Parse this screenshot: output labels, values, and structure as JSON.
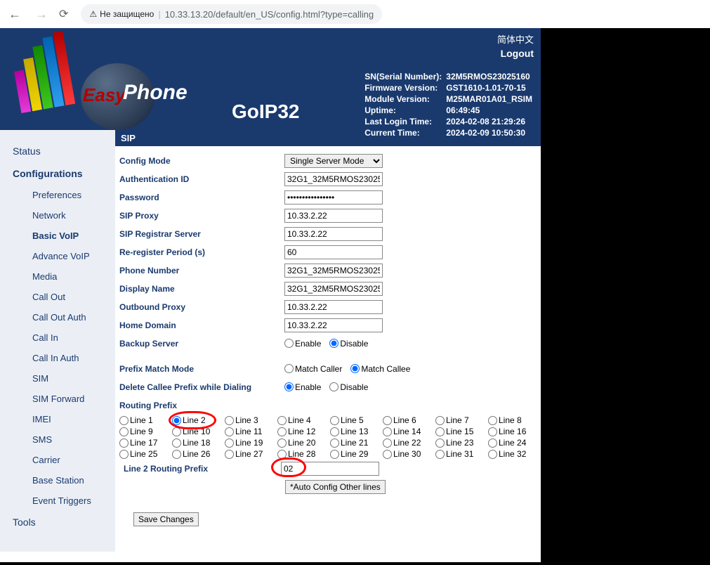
{
  "browser": {
    "secure_label": "Не защищено",
    "url": "10.33.13.20/default/en_US/config.html?type=calling"
  },
  "header": {
    "product": "GoIP32",
    "lang_link": "简体中文",
    "logout": "Logout",
    "info": {
      "sn_label": "SN(Serial Number):",
      "sn": "32M5RMOS23025160",
      "fw_label": "Firmware Version:",
      "fw": "GST1610-1.01-70-15",
      "mod_label": "Module Version:",
      "mod": "M25MAR01A01_RSIM",
      "uptime_label": "Uptime:",
      "uptime": "06:49:45",
      "last_label": "Last Login Time:",
      "last": "2024-02-08 21:29:26",
      "cur_label": "Current Time:",
      "cur": "2024-02-09 10:50:30"
    }
  },
  "sidebar": {
    "status": "Status",
    "config": "Configurations",
    "items": [
      "Preferences",
      "Network",
      "Basic VoIP",
      "Advance VoIP",
      "Media",
      "Call Out",
      "Call Out Auth",
      "Call In",
      "Call In Auth",
      "SIM",
      "SIM Forward",
      "IMEI",
      "SMS",
      "Carrier",
      "Base Station",
      "Event Triggers"
    ],
    "tools": "Tools"
  },
  "sip": {
    "title": "SIP",
    "labels": {
      "config_mode": "Config Mode",
      "auth_id": "Authentication ID",
      "password": "Password",
      "sip_proxy": "SIP Proxy",
      "sip_reg": "SIP Registrar Server",
      "rereg": "Re-register Period (s)",
      "phone": "Phone Number",
      "display": "Display Name",
      "outbound": "Outbound Proxy",
      "home": "Home Domain",
      "backup": "Backup Server",
      "prefix_mode": "Prefix Match Mode",
      "del_prefix": "Delete Callee Prefix while Dialing",
      "route_prefix": "Routing Prefix",
      "line_prefix": "Line 2 Routing Prefix"
    },
    "values": {
      "config_mode": "Single Server Mode",
      "auth_id": "32G1_32M5RMOS23025",
      "password": "••••••••••••••••",
      "sip_proxy": "10.33.2.22",
      "sip_reg": "10.33.2.22",
      "rereg": "60",
      "phone": "32G1_32M5RMOS23025",
      "display": "32G1_32M5RMOS23025",
      "outbound": "10.33.2.22",
      "home": "10.33.2.22",
      "line_prefix": "02"
    },
    "radio": {
      "enable": "Enable",
      "disable": "Disable",
      "caller": "Match Caller",
      "callee": "Match Callee"
    },
    "lines": [
      "Line 1",
      "Line 2",
      "Line 3",
      "Line 4",
      "Line 5",
      "Line 6",
      "Line 7",
      "Line 8",
      "Line 9",
      "Line 10",
      "Line 11",
      "Line 12",
      "Line 13",
      "Line 14",
      "Line 15",
      "Line 16",
      "Line 17",
      "Line 18",
      "Line 19",
      "Line 20",
      "Line 21",
      "Line 22",
      "Line 23",
      "Line 24",
      "Line 25",
      "Line 26",
      "Line 27",
      "Line 28",
      "Line 29",
      "Line 30",
      "Line 31",
      "Line 32"
    ],
    "auto_btn": "*Auto Config Other lines",
    "save_btn": "Save Changes"
  }
}
